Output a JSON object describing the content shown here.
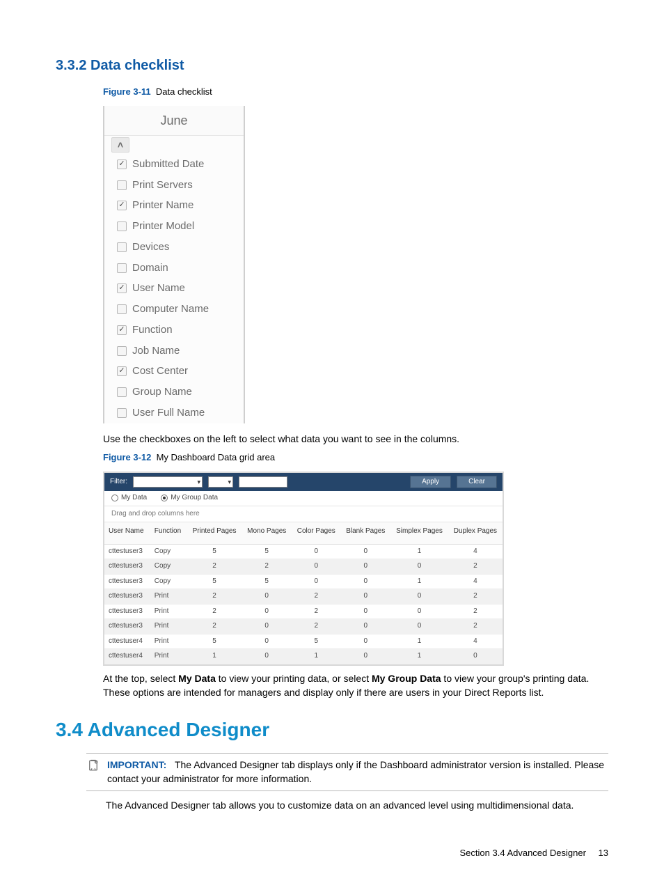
{
  "section332": {
    "heading": "3.3.2 Data checklist",
    "figure": {
      "label": "Figure 3-11",
      "caption": "Data checklist"
    },
    "checklist": {
      "header": "June",
      "items": [
        {
          "label": "Submitted Date",
          "checked": true
        },
        {
          "label": "Print Servers",
          "checked": false
        },
        {
          "label": "Printer Name",
          "checked": true
        },
        {
          "label": "Printer Model",
          "checked": false
        },
        {
          "label": "Devices",
          "checked": false
        },
        {
          "label": "Domain",
          "checked": false
        },
        {
          "label": "User Name",
          "checked": true
        },
        {
          "label": "Computer Name",
          "checked": false
        },
        {
          "label": "Function",
          "checked": true
        },
        {
          "label": "Job Name",
          "checked": false
        },
        {
          "label": "Cost Center",
          "checked": true
        },
        {
          "label": "Group Name",
          "checked": false
        },
        {
          "label": "User Full Name",
          "checked": false
        }
      ]
    },
    "body": "Use the checkboxes on the left to select what data you want to see in the columns."
  },
  "figure312": {
    "label": "Figure 3-12",
    "caption": "My Dashboard Data grid area",
    "filter": {
      "label": "Filter:",
      "apply": "Apply",
      "clear": "Clear"
    },
    "radios": {
      "mydata": "My Data",
      "mygroup": "My Group Data",
      "selected": "mygroup"
    },
    "dragrow": "Drag and drop columns here",
    "columns": [
      "User Name",
      "Function",
      "Printed Pages",
      "Mono Pages",
      "Color Pages",
      "Blank Pages",
      "Simplex Pages",
      "Duplex Pages"
    ],
    "rows": [
      [
        "cttestuser3",
        "Copy",
        5,
        5,
        0,
        0,
        1,
        4
      ],
      [
        "cttestuser3",
        "Copy",
        2,
        2,
        0,
        0,
        0,
        2
      ],
      [
        "cttestuser3",
        "Copy",
        5,
        5,
        0,
        0,
        1,
        4
      ],
      [
        "cttestuser3",
        "Print",
        2,
        0,
        2,
        0,
        0,
        2
      ],
      [
        "cttestuser3",
        "Print",
        2,
        0,
        2,
        0,
        0,
        2
      ],
      [
        "cttestuser3",
        "Print",
        2,
        0,
        2,
        0,
        0,
        2
      ],
      [
        "cttestuser4",
        "Print",
        5,
        0,
        5,
        0,
        1,
        4
      ],
      [
        "cttestuser4",
        "Print",
        1,
        0,
        1,
        0,
        1,
        0
      ]
    ]
  },
  "gridBody": {
    "pre": "At the top, select ",
    "b1": "My Data",
    "mid": " to view your printing data, or select ",
    "b2": "My Group Data",
    "post": " to view your group's printing data. These options are intended for managers and display only if there are users in your Direct Reports list."
  },
  "section34": {
    "heading": "3.4 Advanced Designer",
    "note": {
      "label": "IMPORTANT:",
      "text": "The Advanced Designer tab displays only if the Dashboard administrator version is installed. Please contact your administrator for more information."
    },
    "body": "The Advanced Designer tab allows you to customize data on an advanced level using multidimensional data."
  },
  "footer": {
    "section": "Section 3.4   Advanced Designer",
    "page": "13"
  }
}
